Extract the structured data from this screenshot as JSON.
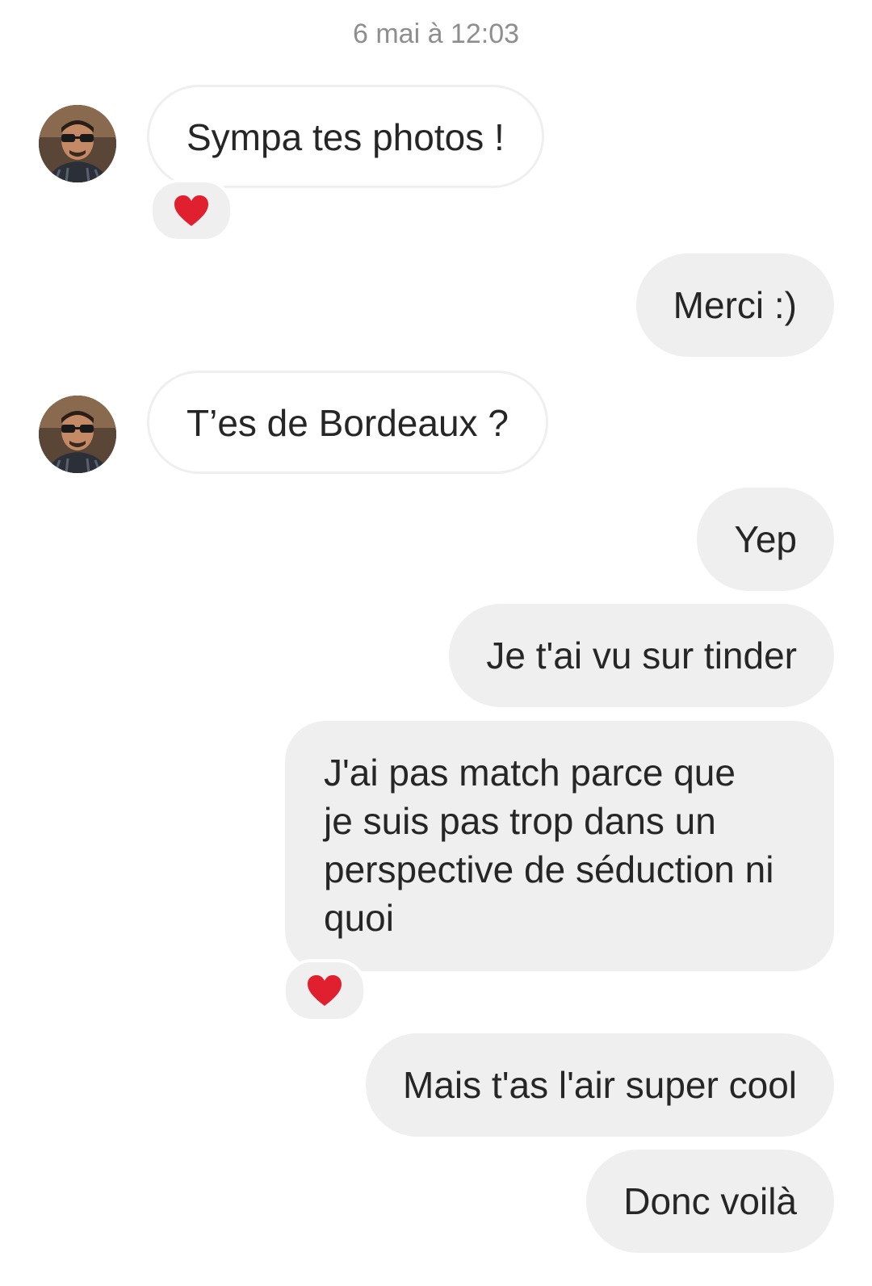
{
  "thread": {
    "timestamp": "6 mai à 12:03",
    "messages": [
      {
        "id": "m1",
        "from": "them",
        "text": "Sympa tes photos !",
        "reaction": "heart"
      },
      {
        "id": "m2",
        "from": "me",
        "text": "Merci :)"
      },
      {
        "id": "m3",
        "from": "them",
        "text": "T’es de Bordeaux ?"
      },
      {
        "id": "m4",
        "from": "me",
        "text": "Yep"
      },
      {
        "id": "m5",
        "from": "me",
        "text": "Je t'ai vu sur tinder"
      },
      {
        "id": "m6",
        "from": "me",
        "lines": [
          "J'ai pas match parce que",
          "je suis pas trop dans un",
          "perspective de séduction ni",
          "quoi"
        ],
        "reaction": "heart"
      },
      {
        "id": "m7",
        "from": "me",
        "text": "Mais t'as l'air super cool"
      },
      {
        "id": "m8",
        "from": "me",
        "text": "Donc voilà"
      }
    ]
  },
  "colors": {
    "outgoing_bubble": "#efefef",
    "incoming_border": "#efefef",
    "timestamp": "#8e8e8e",
    "heart": "#e0202e"
  },
  "icons": {
    "reaction": "heart-icon",
    "avatar": "sender-avatar"
  }
}
